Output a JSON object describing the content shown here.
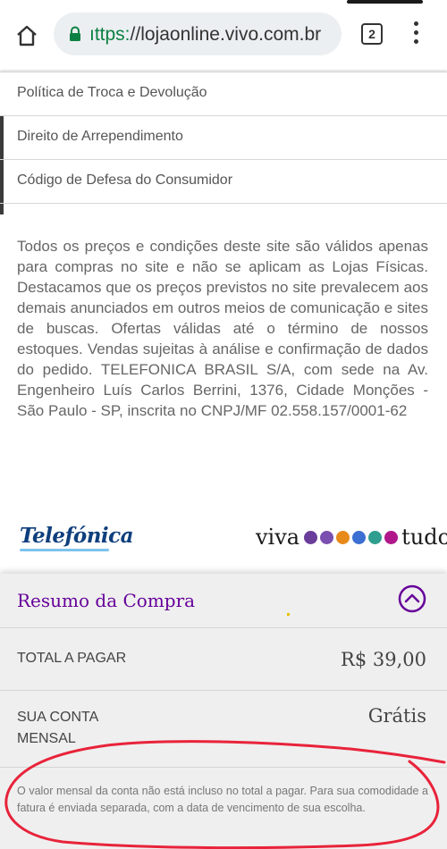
{
  "browser": {
    "url_scheme": "ıttps:",
    "url_rest": "//lojaonline.vivo.com.br",
    "tab_count": "2"
  },
  "footer_links": [
    {
      "label": "Política de Troca e Devolução"
    },
    {
      "label": "Direito de Arrependimento"
    },
    {
      "label": "Código de Defesa do Consumidor"
    }
  ],
  "legal_text": "Todos os preços e condições deste site são válidos apenas para compras no site e não se aplicam as Lojas Físicas. Destacamos que os preços previstos no site prevalecem aos demais anunciados em outros meios de comunicação e sites de buscas. Ofertas válidas até o término de nossos estoques. Vendas sujeitas à análise e confirmação de dados do pedido. TELEFONICA BRASIL S/A, com sede na Av. Engenheiro Luís Carlos Berrini, 1376, Cidade Monções - São Paulo - SP, inscrita no CNPJ/MF 02.558.157/0001-62",
  "logos": {
    "telefonica": "Telefónica",
    "viva_word": "viva",
    "tudo_word": "tudo",
    "dot_colors": [
      "#6a3d9a",
      "#7b4fb0",
      "#e88a1a",
      "#3b6fd1",
      "#2f9e8f",
      "#b0178b"
    ]
  },
  "summary": {
    "title": "Resumo da Compra",
    "total_label": "TOTAL A PAGAR",
    "total_value": "R$ 39,00",
    "monthly_label_line1": "SUA CONTA",
    "monthly_label_line2": "MENSAL",
    "monthly_value": "Grátis",
    "disclaimer": "O valor mensal da conta não está incluso no total a pagar. Para sua comodidade a fatura é enviada separada, com a data de vencimento de sua escolha."
  },
  "colors": {
    "brand_purple": "#660099",
    "annotation_red": "#e8233a"
  }
}
